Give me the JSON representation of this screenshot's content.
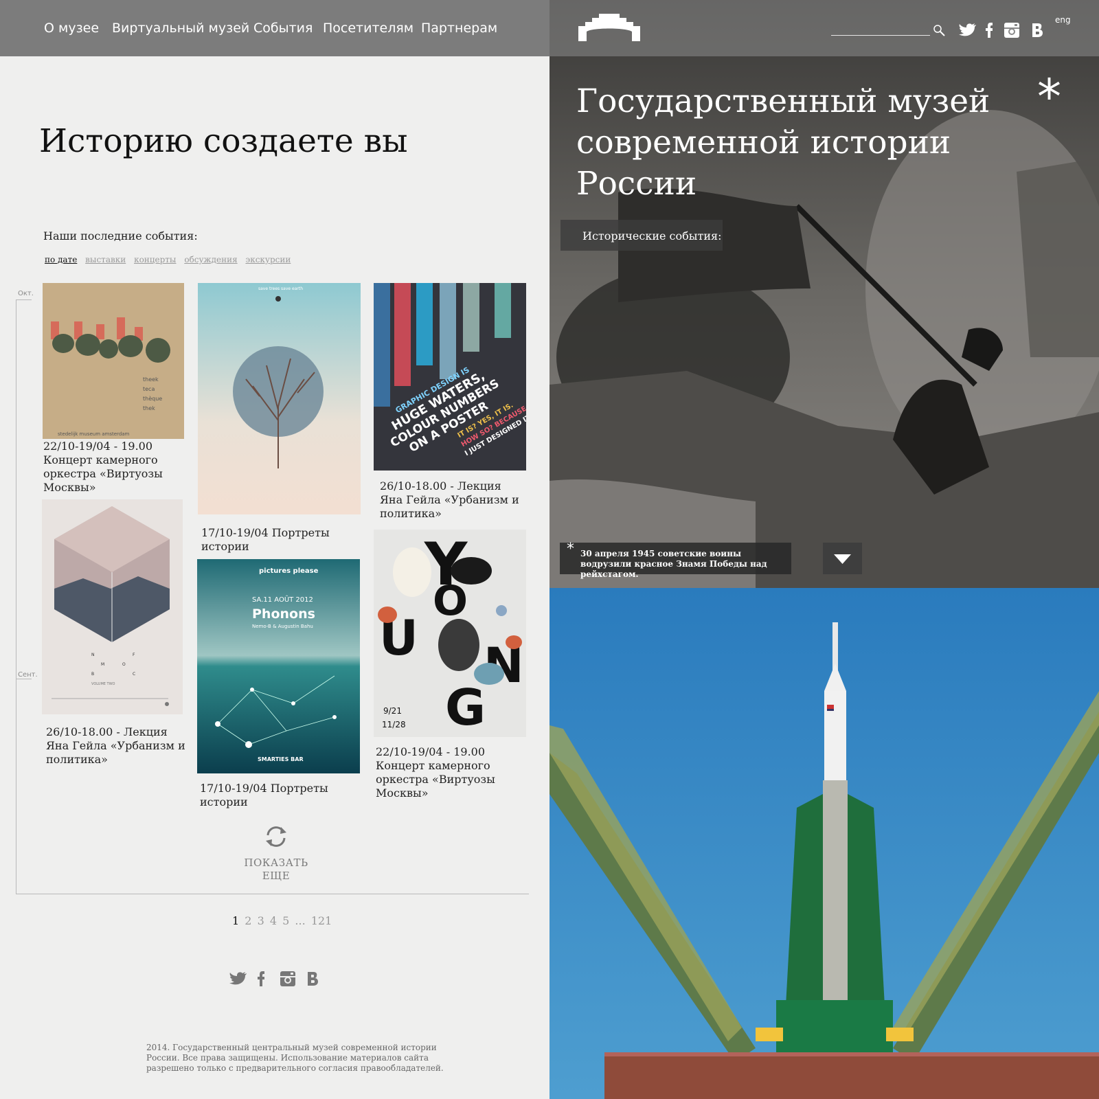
{
  "nav": {
    "items": [
      "О музее",
      "Виртуальный музей",
      "События",
      "Посетителям",
      "Партнерам"
    ]
  },
  "page_title": "Историю создаете вы",
  "events": {
    "heading": "Наши последние события:",
    "filters": [
      "по дате",
      "выставки",
      "концерты",
      "обсуждения",
      "экскурсии"
    ],
    "active_filter": "по дате",
    "timeline_labels": [
      "Окт.",
      "Сент."
    ],
    "cards": [
      {
        "text": "22/10-19/04 - 19.00 Концерт камерного оркестра «Виртуозы Москвы»"
      },
      {
        "text": "17/10-19/04 Портреты истории"
      },
      {
        "text": "26/10-18.00 - Лекция Яна Гейла «Урбанизм и политика»"
      },
      {
        "text": "26/10-18.00 - Лекция Яна Гейла «Урбанизм и политика»"
      },
      {
        "text": "17/10-19/04 Портреты истории"
      },
      {
        "text": "22/10-19/04 - 19.00 Концерт камерного оркестра «Виртуозы Москвы»"
      }
    ],
    "poster_texts": {
      "p1": [
        "theek",
        "teca",
        "thèque",
        "thek",
        "stedelijk museum amsterdam"
      ],
      "p2": "save trees save earth",
      "p3": [
        "GRAPHIC DESIGN IS",
        "HUGE WATERS,",
        "COLOUR NUMBERS",
        "ON A POSTER",
        "IT IS? YES, IT IS.",
        "HOW SO? BECAUSE",
        "I JUST DESIGNED IT."
      ],
      "p4": [
        "N",
        "F",
        "M",
        "O",
        "B",
        "C",
        "VOLUME TWO"
      ],
      "p5": [
        "pictures please",
        "SA.11 AOÛT 2012",
        "Phonons",
        "Nemo-B & Augustin Bahu",
        "SMARTIES BAR"
      ],
      "p6": [
        "Y",
        "O",
        "U",
        "N",
        "G",
        "9/21",
        "11/28"
      ]
    }
  },
  "show_more": "ПОКАЗАТЬ ЕЩЕ",
  "pagination": {
    "pages": [
      "1",
      "2",
      "3",
      "4",
      "5",
      "...",
      "121"
    ],
    "current": "1"
  },
  "social": [
    "twitter-icon",
    "facebook-icon",
    "instagram-icon",
    "vk-icon"
  ],
  "footer": "2014. Государственный центральный музей современной истории России. Все права защищены. Использование материалов сайта разрешено только с предварительного согласия правообладателей.",
  "hero": {
    "title": "Государственный музей современной истории России",
    "asterisk": "*",
    "historical_button": "Исторические события:",
    "caption": "30 апреля 1945 советские воины водрузили красное Знамя Победы над рейхстагом.",
    "caption_star": "*",
    "lang": "eng"
  },
  "colors": {
    "nav_bg": "#7c7c7c",
    "page_bg": "#efefee",
    "sky": "#3c8cc4",
    "rocket_green": "#1e7a42"
  }
}
